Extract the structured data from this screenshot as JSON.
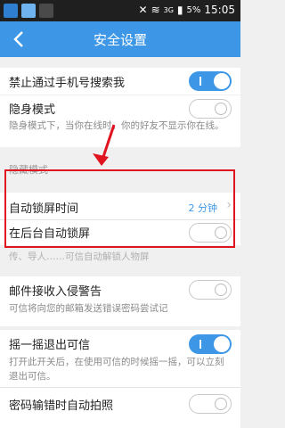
{
  "status_bar": {
    "time": "15:05",
    "battery": "5%",
    "network": "3G"
  },
  "app_bar": {
    "title": "安全设置",
    "back_icon": "chevron-left-icon"
  },
  "settings": {
    "disable_phone_search": {
      "label": "禁止通过手机号搜索我",
      "state": "on"
    },
    "stealth_mode": {
      "label": "隐身模式",
      "description": "隐身模式下，当你在线时，你的好友不显示你在线。",
      "state": "off"
    },
    "hidden_mode_header": "隐藏模式",
    "auto_lock_time": {
      "label": "自动锁屏时间",
      "value": "2 分钟"
    },
    "background_auto_lock": {
      "label": "在后台自动锁屏",
      "state": "off"
    },
    "hidden_row_caption": "传、导人……可信自动解锁人物屏",
    "mail_intrusion_alert": {
      "label": "邮件接收入侵警告",
      "description": "可信将向您的邮箱发送错误密码尝试记",
      "state": "off"
    },
    "shake_exit": {
      "label": "摇一摇退出可信",
      "description": "打开此开关后，在使用可信的时候摇一摇，可以立刻退出可信。",
      "state": "on"
    },
    "wrong_password_photo": {
      "label": "密码输错时自动拍照",
      "state": "off"
    }
  },
  "colors": {
    "accent": "#3d97e6",
    "highlight": "#e0141e"
  }
}
